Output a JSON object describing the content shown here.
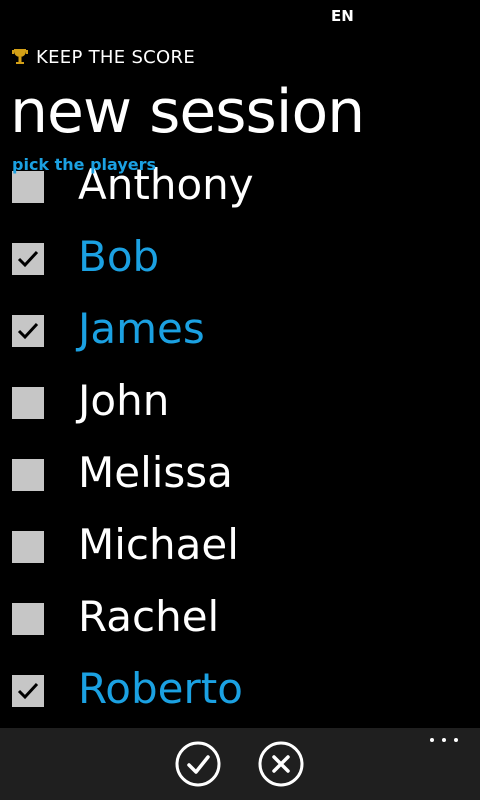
{
  "status_bar": {
    "language": "EN"
  },
  "app": {
    "title": "KEEP THE SCORE",
    "icon": "trophy-icon"
  },
  "page": {
    "title": "new session",
    "section_label": "pick the players"
  },
  "players": [
    {
      "name": "Anthony",
      "checked": false
    },
    {
      "name": "Bob",
      "checked": true
    },
    {
      "name": "James",
      "checked": true
    },
    {
      "name": "John",
      "checked": false
    },
    {
      "name": "Melissa",
      "checked": false
    },
    {
      "name": "Michael",
      "checked": false
    },
    {
      "name": "Rachel",
      "checked": false
    },
    {
      "name": "Roberto",
      "checked": true
    }
  ],
  "app_bar": {
    "buttons": [
      {
        "icon": "check-icon"
      },
      {
        "icon": "cancel-icon"
      }
    ],
    "more_icon": "ellipsis-icon"
  },
  "colors": {
    "accent": "#1ba1e2",
    "background": "#000000",
    "app_bar": "#1f1f1f",
    "checkbox": "#c6c6c6"
  }
}
